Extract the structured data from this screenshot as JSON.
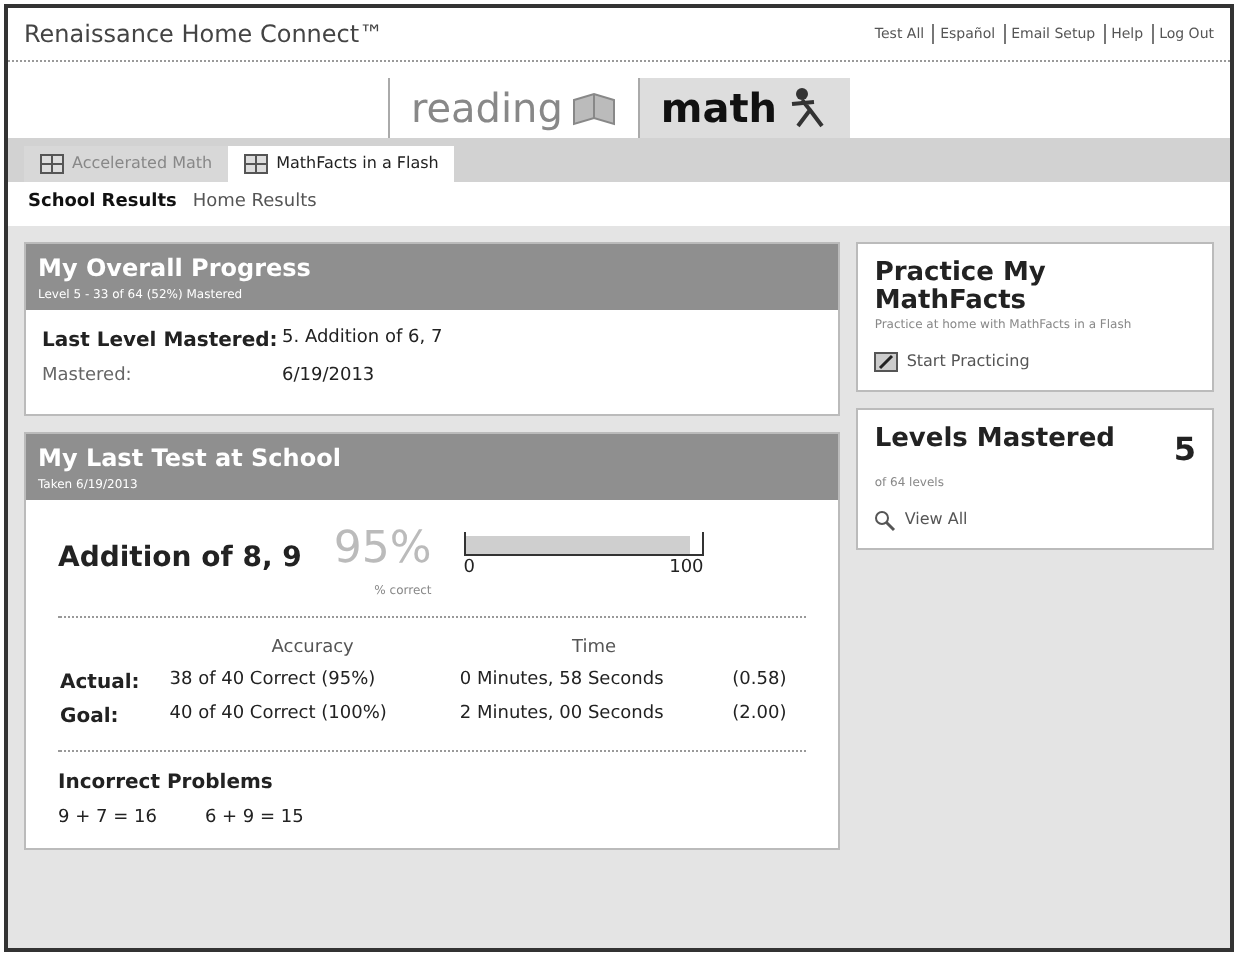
{
  "header": {
    "title": "Renaissance Home Connect™",
    "links": [
      "Test All",
      "Español",
      "Email Setup",
      "Help",
      "Log Out"
    ]
  },
  "subjects": [
    {
      "label": "reading",
      "selected": false
    },
    {
      "label": "math",
      "selected": true
    }
  ],
  "tabs": [
    {
      "label": "Accelerated Math",
      "selected": false
    },
    {
      "label": "MathFacts in a Flash",
      "selected": true
    }
  ],
  "subtabs": [
    {
      "label": "School Results",
      "selected": true
    },
    {
      "label": "Home Results",
      "selected": false
    }
  ],
  "overall": {
    "title": "My Overall Progress",
    "subtitle": "Level 5 - 33 of 64 (52%) Mastered",
    "rows": [
      {
        "label": "Last Level Mastered:",
        "value": "5. Addition of 6, 7",
        "bold": true
      },
      {
        "label": "Mastered:",
        "value": "6/19/2013",
        "bold": false
      }
    ]
  },
  "last_test": {
    "title": "My Last Test at School",
    "subtitle": "Taken 6/19/2013",
    "level_name": "Addition of 8, 9",
    "percent": "95%",
    "percent_label": "% correct",
    "level": 0.95,
    "scale_min": "0",
    "scale_max": "100",
    "columns": [
      "Accuracy",
      "Time"
    ],
    "rows": [
      {
        "label": "Actual:",
        "accuracy": "38 of 40 Correct (95%)",
        "time": "0 Minutes, 58 Seconds",
        "rate": "(0.58)"
      },
      {
        "label": "Goal:",
        "accuracy": "40 of 40 Correct (100%)",
        "time": "2 Minutes, 00 Seconds",
        "rate": "(2.00)"
      }
    ],
    "incorrect_title": "Incorrect Problems",
    "incorrect": [
      "9 + 7 = 16",
      "6 + 9 = 15"
    ]
  },
  "practice": {
    "title": "Practice My MathFacts",
    "subtitle": "Practice at home with MathFacts in a Flash",
    "link": "Start Practicing"
  },
  "levels": {
    "title": "Levels Mastered",
    "count": "5",
    "subtitle": "of 64 levels",
    "link": "View All"
  }
}
